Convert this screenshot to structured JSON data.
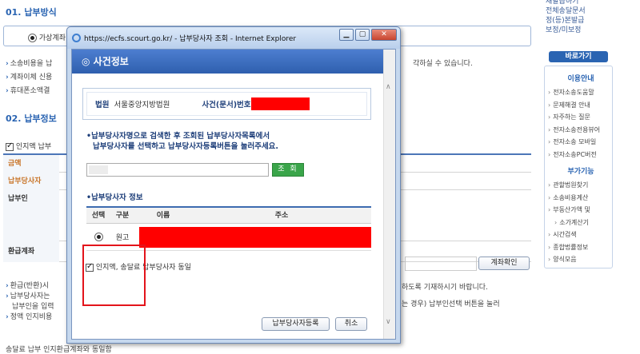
{
  "bg": {
    "section1_title": "01. 납부방식",
    "radio_virtual_label": "가상계좌",
    "lines_top": [
      "소송비용을 납",
      "계좌이체 신용",
      "휴대폰소액결"
    ],
    "lines_top_right": "각하실 수 있습니다.",
    "section2_title": "02. 납부정보",
    "stamp_check": "인지액 납부",
    "row_amount": "금액",
    "row_payer": "납부당사자",
    "row_payer2": "납부인",
    "row_refund": "환급계좌",
    "refund_btn": "계좌확인",
    "lines_bottom": [
      "환급(반환)시",
      "납부당사자는",
      "납부인을 입력",
      "정액 인지비용"
    ],
    "lines_bottom_right1": "하도록 기재하시기 바랍니다.",
    "lines_bottom_right2": "는 경우) 납부인선택 버튼을 눌러",
    "bottom_cut": "송달료 납부   인지환급계좌와 동일함"
  },
  "sidebar": {
    "top_links": [
      "재발급하기",
      "전체송달문서",
      "정(등)본발급",
      "보정/미보정"
    ],
    "goto_btn": "바로가기",
    "guide_title": "이용안내",
    "guide_items": [
      "전자소송도움말",
      "문제해결 안내",
      "자주하는 질문",
      "전자소송전용뷰어",
      "전자소송 모바일",
      "전자소송PC버전"
    ],
    "extra_title": "부가기능",
    "extra_items": [
      "관할법원찾기",
      "소송비용계산",
      "부동산가액 및",
      "소가계산기",
      "시간검색",
      "종합법률정보",
      "양식모음"
    ]
  },
  "popup": {
    "window_title": "https://ecfs.scourt.go.kr/ - 납부당사자 조회 - Internet Explorer",
    "header": "사건정보",
    "court_label": "법원",
    "court_value": "서울중앙지방법원",
    "case_label": "사건(문서)번호",
    "notice_line1": "•납부당사자명으로 검색한 후 조회된 납부당사자목록에서",
    "notice_line2": "납부당사자를 선택하고 납부당사자등록버튼을 눌러주세요.",
    "search_btn": "조 회",
    "section_title": "•납부당사자 정보",
    "columns": [
      "선택",
      "구분",
      "이름",
      "주소"
    ],
    "row_type": "원고",
    "same_as_stamp": "인지액, 송달료 납부당사자 동일",
    "register_btn": "납부당사자등록",
    "cancel_btn": "취소"
  },
  "colors": {
    "accent": "#2a64b2",
    "redaction": "#ff0000",
    "highlight": "#e3141b",
    "search_button": "#3aa54a"
  }
}
